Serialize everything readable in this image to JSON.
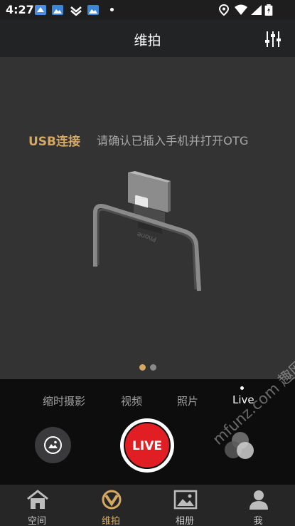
{
  "status_bar": {
    "time": "4:27",
    "icons": [
      "notification-app-icon",
      "photo-app-icon",
      "download-icon",
      "photo-app-icon",
      "location-icon",
      "wifi-icon",
      "signal-icon",
      "battery-icon"
    ]
  },
  "header": {
    "title": "维拍",
    "settings_icon": "sliders-icon"
  },
  "preview": {
    "usb_label": "USB连接",
    "hint": "请确认已插入手机并打开OTG",
    "illustration_text": "Phone",
    "page_dots": 2,
    "active_page": 1
  },
  "modes": {
    "items": [
      "缩时摄影",
      "视频",
      "照片",
      "Live"
    ],
    "selected": "Live"
  },
  "shutter": {
    "label": "LIVE",
    "color": "#e01e23"
  },
  "tabs": [
    {
      "label": "空间",
      "icon": "home-icon",
      "active": false
    },
    {
      "label": "维拍",
      "icon": "camera-brand-icon",
      "active": true
    },
    {
      "label": "相册",
      "icon": "album-icon",
      "active": false
    },
    {
      "label": "我",
      "icon": "profile-icon",
      "active": false
    }
  ],
  "watermark": "mfunz.com 趣网",
  "colors": {
    "accent": "#d6a962",
    "live_red": "#e01e23",
    "background": "#0d0d0d",
    "preview_bg": "#333333"
  }
}
